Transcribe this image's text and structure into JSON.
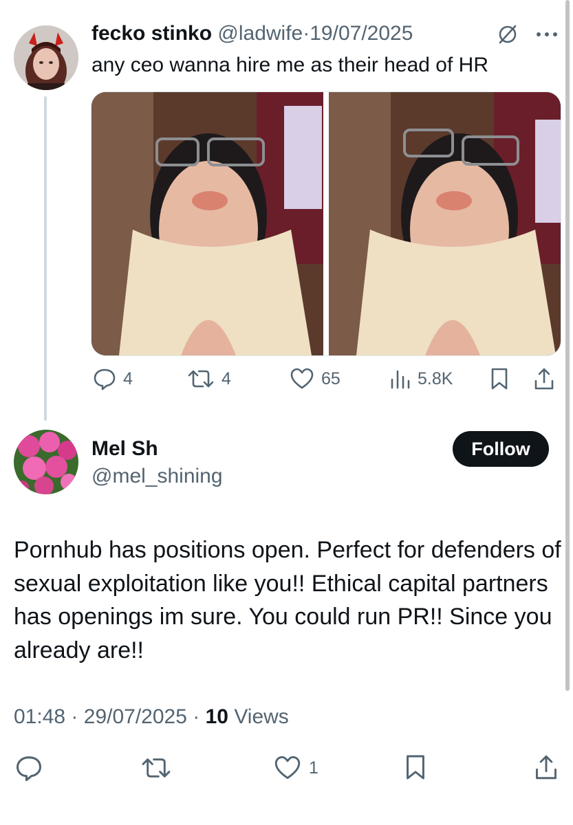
{
  "quoted_tweet": {
    "display_name": "fecko stinko",
    "handle": "@ladwife",
    "separator": "·",
    "date": "19/07/2025",
    "text": "any ceo wanna hire me as their head of HR",
    "more_icon": "more-dots-icon",
    "grok_icon": "slashed-circle-icon",
    "media": [
      "photo-1",
      "photo-2"
    ],
    "actions": {
      "replies": "4",
      "retweets": "4",
      "likes": "65",
      "views": "5.8K"
    }
  },
  "reply": {
    "display_name": "Mel Sh",
    "handle": "@mel_shining",
    "follow_label": "Follow",
    "text": "Pornhub has positions open. Perfect for defenders of sexual exploitation like you!! Ethical capital partners has openings im sure. You could run PR!! Since you already are!!",
    "time": "01:48",
    "separator": "·",
    "date": "29/07/2025",
    "views_count": "10",
    "views_label": "Views",
    "likes": "1"
  },
  "colors": {
    "text": "#0f1419",
    "muted": "#536471",
    "button_bg": "#0f1419",
    "thread_line": "#cfd9de"
  }
}
